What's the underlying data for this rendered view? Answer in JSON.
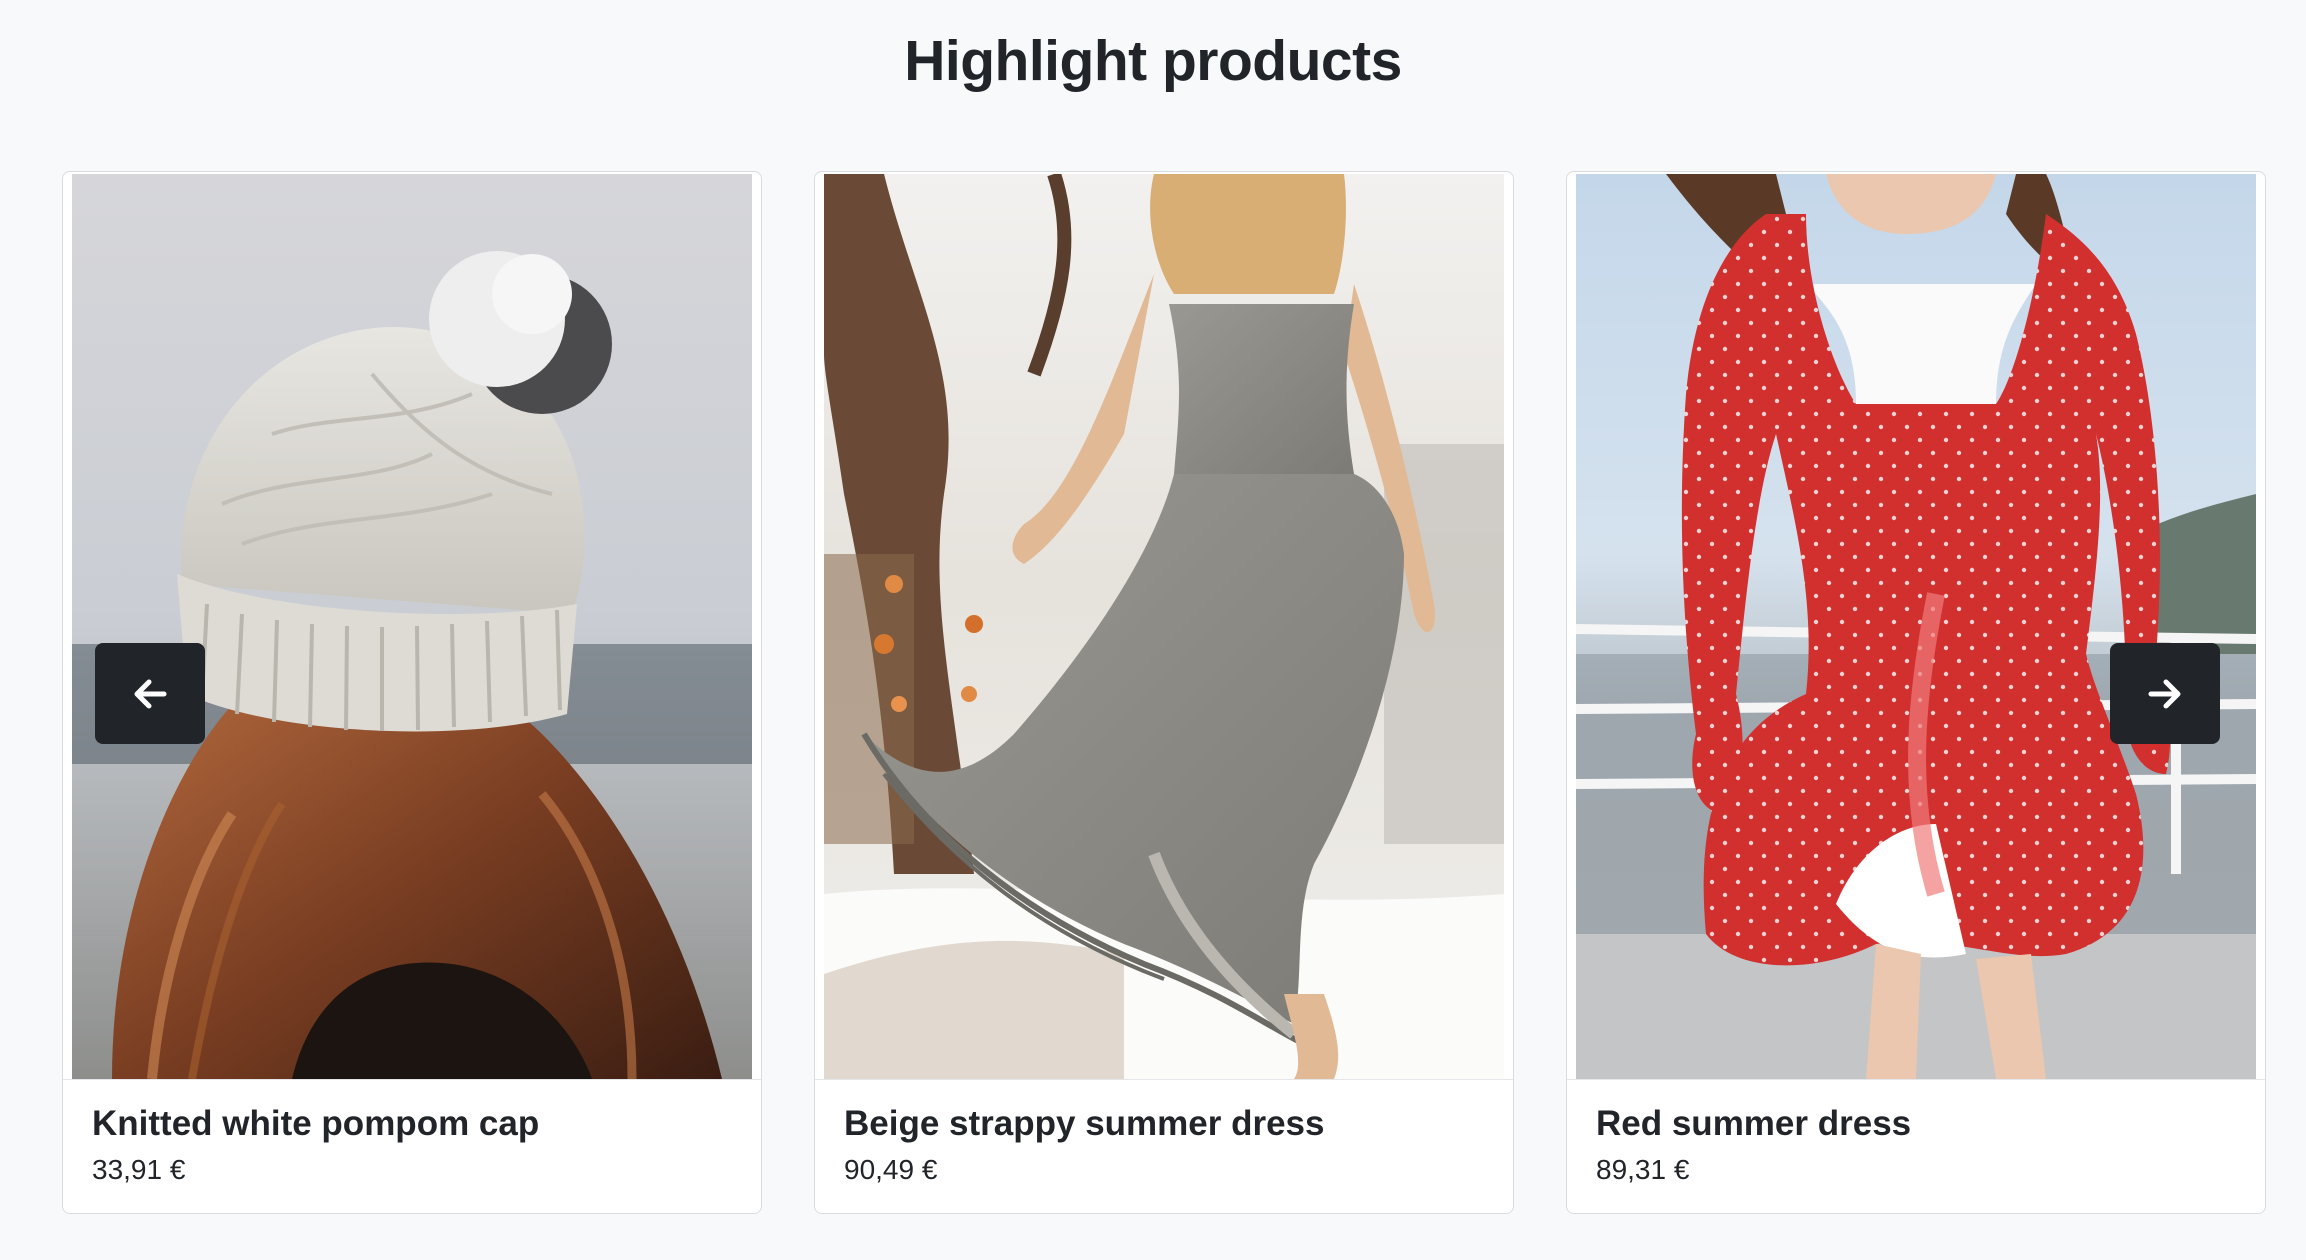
{
  "section": {
    "title": "Highlight products"
  },
  "carousel": {
    "prev_icon": "arrow-left-icon",
    "next_icon": "arrow-right-icon",
    "products": [
      {
        "name": "Knitted white pompom cap",
        "price": "33,91 €"
      },
      {
        "name": "Beige strappy summer dress",
        "price": "90,49 €"
      },
      {
        "name": "Red summer dress",
        "price": "89,31 €"
      }
    ]
  },
  "colors": {
    "page_background": "#f8f9fa",
    "text": "#212529",
    "nav_button": "#212529",
    "card_border": "#d9dbde"
  }
}
